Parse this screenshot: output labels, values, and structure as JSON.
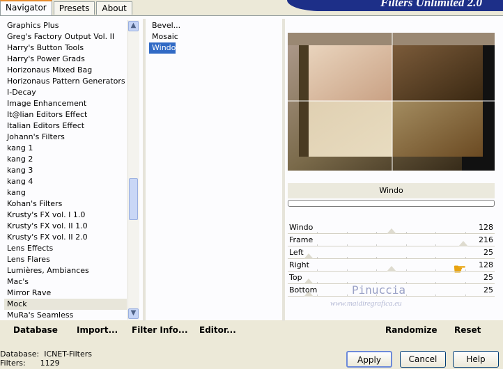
{
  "tabs": [
    "Navigator",
    "Presets",
    "About"
  ],
  "brand": "Filters Unlimited 2.0",
  "categories": [
    "Graphics Plus",
    "Greg's Factory Output Vol. II",
    "Harry's Button Tools",
    "Harry's Power Grads",
    "Horizonaus Mixed Bag",
    "Horizonaus Pattern Generators",
    "I-Decay",
    "Image Enhancement",
    "It@lian Editors Effect",
    "Italian Editors Effect",
    "Johann's Filters",
    "kang 1",
    "kang 2",
    "kang 3",
    "kang 4",
    "kang",
    "Kohan's Filters",
    "Krusty's FX vol. I 1.0",
    "Krusty's FX vol. II 1.0",
    "Krusty's FX vol. II 2.0",
    "Lens Effects",
    "Lens Flares",
    "Lumières, Ambiances",
    "Mac's",
    "Mirror Rave",
    "Mock",
    "MuRa's Seamless"
  ],
  "selected_category": "Mock",
  "filters": [
    "Bevel...",
    "Mosaic",
    "Windo"
  ],
  "selected_filter": "Windo",
  "filter_name": "Windo",
  "sliders": [
    {
      "label": "Windo",
      "value": "128",
      "pos": 0.5
    },
    {
      "label": "Frame",
      "value": "216",
      "pos": 0.85
    },
    {
      "label": "Left",
      "value": "25",
      "pos": 0.1
    },
    {
      "label": "Right",
      "value": "128",
      "pos": 0.5
    },
    {
      "label": "Top",
      "value": "25",
      "pos": 0.1
    },
    {
      "label": "Bottom",
      "value": "25",
      "pos": 0.1
    }
  ],
  "watermark": {
    "name": "Pinuccia",
    "site": "www.maidiregrafica.eu"
  },
  "bottom_buttons": {
    "database": "Database",
    "import": "Import...",
    "filter_info": "Filter Info...",
    "editor": "Editor...",
    "randomize": "Randomize",
    "reset": "Reset"
  },
  "info": {
    "database_label": "Database:",
    "database_value": "ICNET-Filters",
    "filters_label": "Filters:",
    "filters_value": "1129"
  },
  "dialog_buttons": {
    "apply": "Apply",
    "cancel": "Cancel",
    "help": "Help"
  }
}
